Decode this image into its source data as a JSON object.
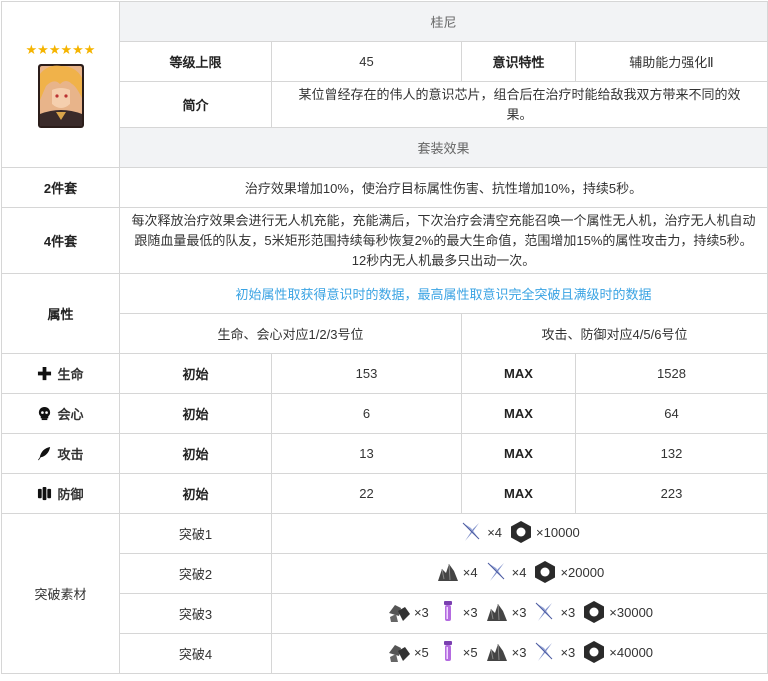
{
  "card": {
    "stars": "★★★★★★",
    "name": "桂尼",
    "level_label": "等级上限",
    "level_value": "45",
    "trait_label": "意识特性",
    "trait_value": "辅助能力强化Ⅱ",
    "intro_label": "简介",
    "intro_text": "某位曾经存在的伟人的意识芯片，组合后在治疗时能给敌我双方带来不同的效果。"
  },
  "set_effects": {
    "header": "套装效果",
    "two_label": "2件套",
    "two_text": "治疗效果增加10%，使治疗目标属性伤害、抗性增加10%，持续5秒。",
    "four_label": "4件套",
    "four_text": "每次释放治疗效果会进行无人机充能，充能满后，下次治疗会清空充能召唤一个属性无人机，治疗无人机自动跟随血量最低的队友，5米矩形范围持续每秒恢复2%的最大生命值，范围增加15%的属性攻击力，持续5秒。12秒内无人机最多只出动一次。"
  },
  "attributes": {
    "label": "属性",
    "note": "初始属性取获得意识时的数据，最高属性取意识完全突破且满级时的数据",
    "left_slots": "生命、会心对应1/2/3号位",
    "right_slots": "攻击、防御对应4/5/6号位",
    "init_label": "初始",
    "max_label": "MAX",
    "rows": [
      {
        "name": "生命",
        "icon": "cross-icon",
        "init": "153",
        "max": "1528"
      },
      {
        "name": "会心",
        "icon": "skull-icon",
        "init": "6",
        "max": "64"
      },
      {
        "name": "攻击",
        "icon": "feather-icon",
        "init": "13",
        "max": "132"
      },
      {
        "name": "防御",
        "icon": "shield-icon",
        "init": "22",
        "max": "223"
      }
    ]
  },
  "breakthrough": {
    "label": "突破素材",
    "rows": [
      {
        "name": "突破1",
        "items": [
          {
            "icon": "blade-shard-icon",
            "count": "×4"
          },
          {
            "icon": "hex-nut-icon",
            "count": "×10000"
          }
        ]
      },
      {
        "name": "突破2",
        "items": [
          {
            "icon": "rock-chunk-icon",
            "count": "×4"
          },
          {
            "icon": "blade-shard-icon",
            "count": "×4"
          },
          {
            "icon": "hex-nut-icon",
            "count": "×20000"
          }
        ]
      },
      {
        "name": "突破3",
        "items": [
          {
            "icon": "ore-cluster-icon",
            "count": "×3"
          },
          {
            "icon": "purple-vial-icon",
            "count": "×3"
          },
          {
            "icon": "rock-chunk-icon",
            "count": "×3"
          },
          {
            "icon": "blade-shard-icon",
            "count": "×3"
          },
          {
            "icon": "hex-nut-icon",
            "count": "×30000"
          }
        ]
      },
      {
        "name": "突破4",
        "items": [
          {
            "icon": "ore-cluster-icon",
            "count": "×5"
          },
          {
            "icon": "purple-vial-icon",
            "count": "×5"
          },
          {
            "icon": "rock-chunk-icon",
            "count": "×3"
          },
          {
            "icon": "blade-shard-icon",
            "count": "×3"
          },
          {
            "icon": "hex-nut-icon",
            "count": "×40000"
          }
        ]
      }
    ]
  },
  "colors": {
    "accent_blue": "#3aa3e3",
    "header_bg": "#f2f3f5",
    "star": "#f5b400",
    "border": "#d6d6d6"
  }
}
